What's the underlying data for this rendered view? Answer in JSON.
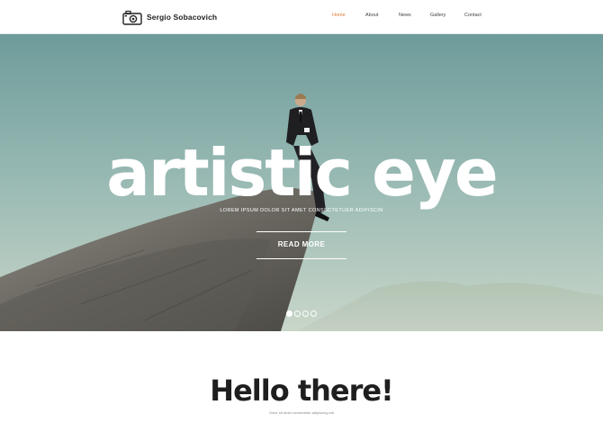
{
  "header": {
    "brand_name": "Sergio Sobacovich",
    "brand_icon": "camera-icon",
    "nav": [
      {
        "label": "Home",
        "active": true
      },
      {
        "label": "About",
        "active": false
      },
      {
        "label": "News",
        "active": false
      },
      {
        "label": "Gallery",
        "active": false
      },
      {
        "label": "Contact",
        "active": false
      }
    ]
  },
  "hero": {
    "title": "artistic eye",
    "subtitle": "LOREM IPSUM DOLOR SIT AMET CONSECTETUER ADIPISCIN",
    "button_label": "READ MORE",
    "slides_count": 4,
    "active_slide": 1
  },
  "intro": {
    "title": "Hello there!",
    "subtitle": "Dolor sit amet consectetur adipiscing elit"
  },
  "colors": {
    "accent": "#e07b39",
    "text": "#1f1f1f",
    "hero_sky": "#7fa6a4"
  }
}
